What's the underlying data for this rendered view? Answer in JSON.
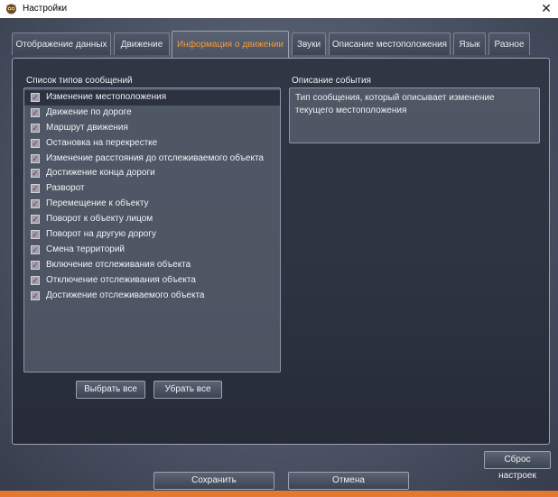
{
  "window": {
    "title": "Настройки",
    "close_glyph": "✕"
  },
  "tabs": [
    {
      "label": "Отображение данных",
      "active": false
    },
    {
      "label": "Движение",
      "active": false
    },
    {
      "label": "Информация о движении",
      "active": true
    },
    {
      "label": "Звуки",
      "active": false
    },
    {
      "label": "Описание местоположения",
      "active": false
    },
    {
      "label": "Язык",
      "active": false
    },
    {
      "label": "Разное",
      "active": false
    }
  ],
  "message_list": {
    "label": "Список типов сообщений",
    "items": [
      {
        "label": "Изменение местоположения",
        "checked": true,
        "selected": true
      },
      {
        "label": "Движение по дороге",
        "checked": true
      },
      {
        "label": "Маршрут движения",
        "checked": true
      },
      {
        "label": "Остановка на перекрестке",
        "checked": true
      },
      {
        "label": "Изменение расстояния до отслеживаемого объекта",
        "checked": true
      },
      {
        "label": "Достижение конца дороги",
        "checked": true
      },
      {
        "label": "Разворот",
        "checked": true
      },
      {
        "label": "Перемещение к объекту",
        "checked": true
      },
      {
        "label": "Поворот к объекту лицом",
        "checked": true
      },
      {
        "label": "Поворот на другую дорогу",
        "checked": true
      },
      {
        "label": "Смена территорий",
        "checked": true
      },
      {
        "label": "Включение отслеживания объекта",
        "checked": true
      },
      {
        "label": "Отключение отслеживания объекта",
        "checked": true
      },
      {
        "label": "Достижение отслеживаемого объекта",
        "checked": true
      }
    ],
    "check_glyph": "✓"
  },
  "event_description": {
    "label": "Описание события",
    "text": "Тип сообщения, который описывает изменение текущего местоположения"
  },
  "buttons": {
    "select_all": "Выбрать все",
    "clear_all": "Убрать все",
    "reset": "Сброс настроек",
    "save": "Сохранить",
    "cancel": "Отмена"
  },
  "colors": {
    "active_tab": "#f39a3a",
    "accent_bar": "#e4782d",
    "check": "#9e2a2a"
  },
  "icons": {
    "app": "owl-icon",
    "close": "close-icon",
    "check": "checkmark-icon"
  }
}
